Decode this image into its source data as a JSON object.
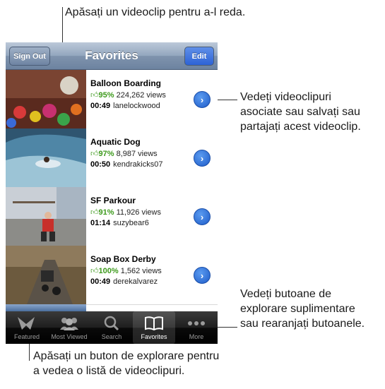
{
  "callouts": {
    "top": "Apăsați un videoclip pentru a-l reda.",
    "right_top": [
      "Vedeți videoclipuri",
      "asociate sau salvați sau",
      "partajați acest videoclip."
    ],
    "right_bottom": [
      "Vedeți butoane de",
      "explorare suplimentare",
      "sau rearanjați butoanele."
    ],
    "bottom": [
      "Apăsați un buton de explorare pentru",
      "a vedea o listă de videoclipuri."
    ]
  },
  "navbar": {
    "title": "Favorites",
    "left_button": "Sign Out",
    "right_button": "Edit"
  },
  "videos": [
    {
      "title": "Balloon Boarding",
      "rating": "95%",
      "views": "224,262 views",
      "duration": "00:49",
      "user": "lanelockwood"
    },
    {
      "title": "Aquatic Dog",
      "rating": "97%",
      "views": "8,987 views",
      "duration": "00:50",
      "user": "kendrakicks07"
    },
    {
      "title": "SF Parkour",
      "rating": "91%",
      "views": "11,926 views",
      "duration": "01:14",
      "user": "suzybear6"
    },
    {
      "title": "Soap Box Derby",
      "rating": "100%",
      "views": "1,562 views",
      "duration": "00:49",
      "user": "derekalvarez"
    }
  ],
  "tabs": [
    {
      "label": "Featured",
      "icon": "featured-icon"
    },
    {
      "label": "Most Viewed",
      "icon": "most-viewed-icon"
    },
    {
      "label": "Search",
      "icon": "search-icon"
    },
    {
      "label": "Favorites",
      "icon": "favorites-book-icon",
      "selected": true
    },
    {
      "label": "More",
      "icon": "more-dots-icon"
    }
  ],
  "colors": {
    "rating_green": "#3d9a1c",
    "edit_blue": "#2d63d6",
    "nav_bar": "#6d83a0"
  }
}
